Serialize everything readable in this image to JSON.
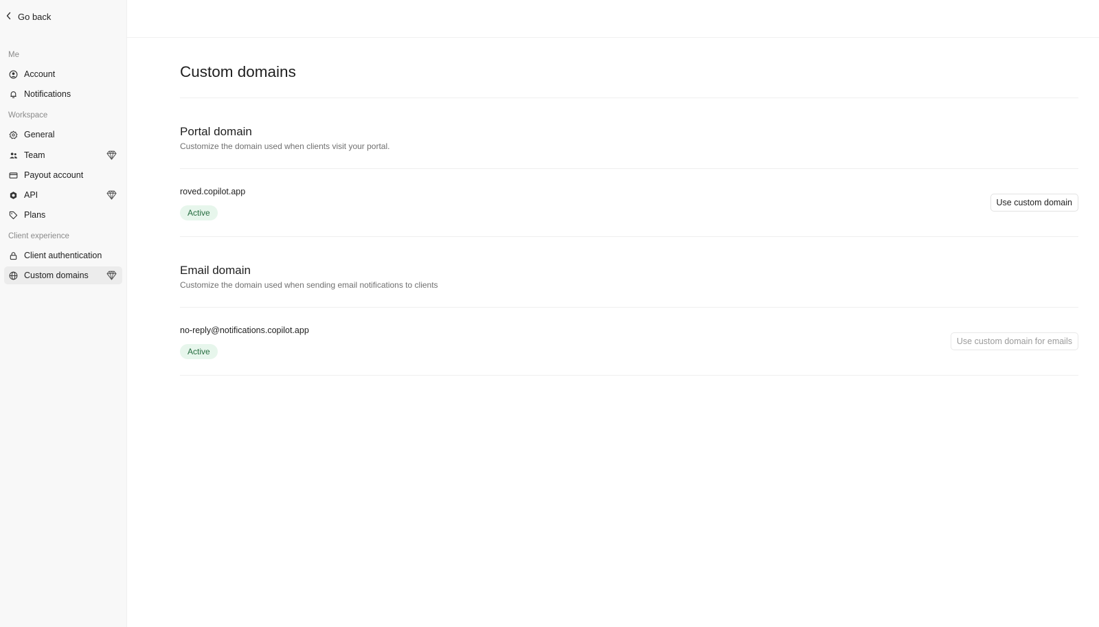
{
  "sidebar": {
    "back_label": "Go back",
    "sections": {
      "me": "Me",
      "workspace": "Workspace",
      "client_experience": "Client experience"
    },
    "items": {
      "account": "Account",
      "notifications": "Notifications",
      "general": "General",
      "team": "Team",
      "payout_account": "Payout account",
      "api": "API",
      "plans": "Plans",
      "client_authentication": "Client authentication",
      "custom_domains": "Custom domains"
    },
    "active_item": "Custom domains"
  },
  "page": {
    "title": "Custom domains"
  },
  "portal": {
    "heading": "Portal domain",
    "description": "Customize the domain used when clients visit your portal.",
    "domain": "roved.copilot.app",
    "status": "Active",
    "button": "Use custom domain"
  },
  "email": {
    "heading": "Email domain",
    "description": "Customize the domain used when sending email notifications to clients",
    "address": "no-reply@notifications.copilot.app",
    "status": "Active",
    "button": "Use custom domain for emails"
  },
  "colors": {
    "sidebar_bg": "#f8f8f8",
    "active_item_bg": "#ececec",
    "badge_bg": "#e7f6ec",
    "badge_text": "#246b3e"
  }
}
